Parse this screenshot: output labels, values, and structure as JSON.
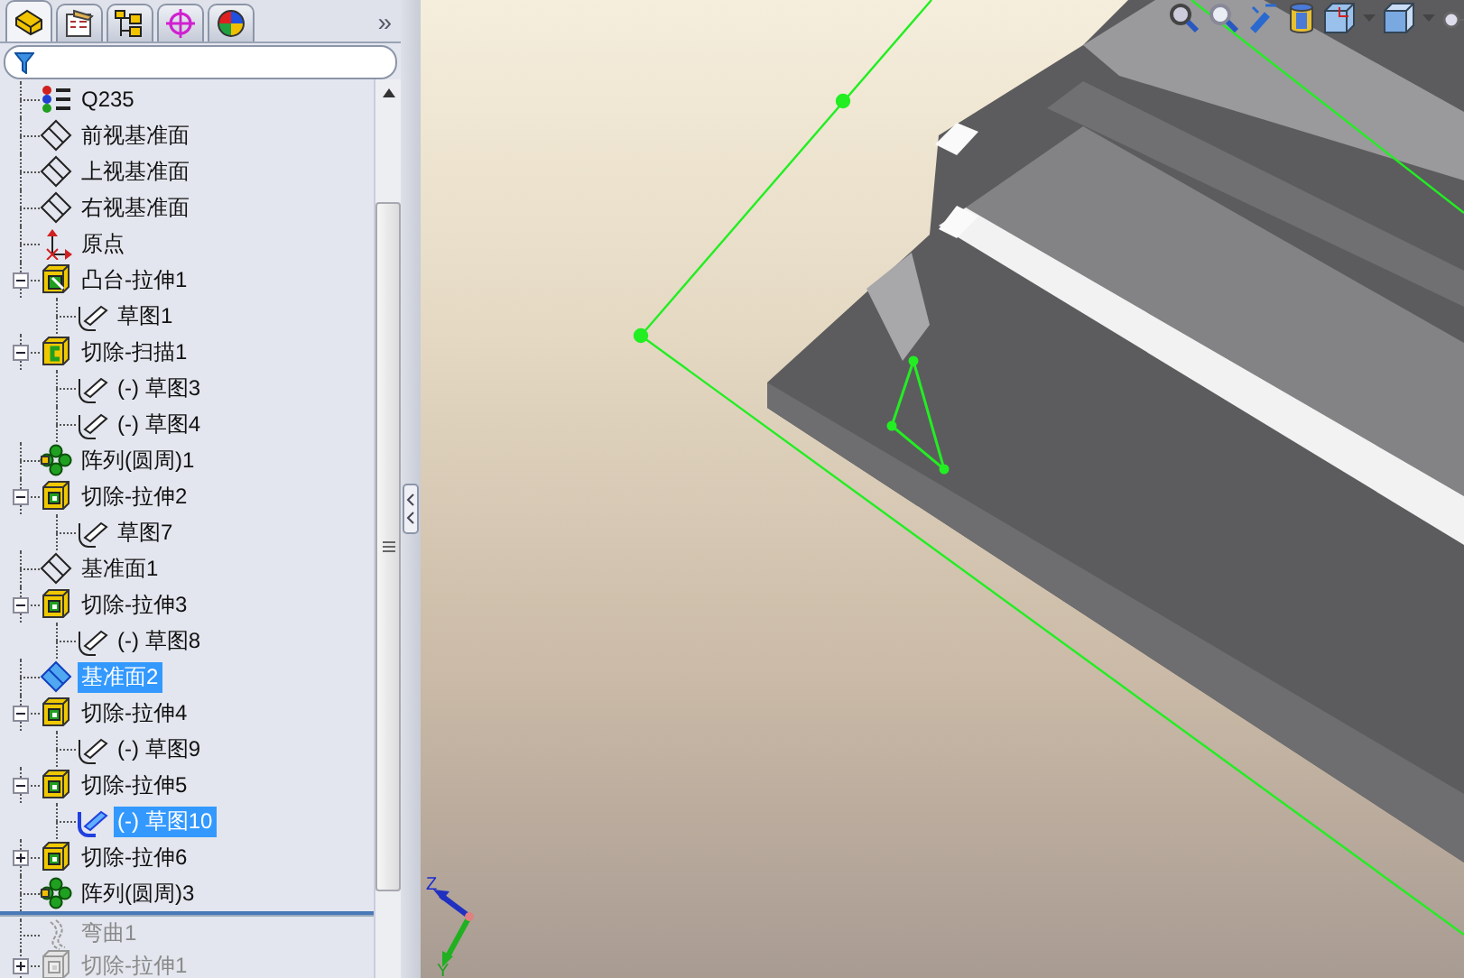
{
  "tabs": [
    {
      "kind": "features",
      "selected": true
    },
    {
      "kind": "properties",
      "selected": false
    },
    {
      "kind": "configurations",
      "selected": false
    },
    {
      "kind": "dimxpert",
      "selected": false
    },
    {
      "kind": "display",
      "selected": false
    }
  ],
  "more_tabs": "»",
  "tree": {
    "items": [
      {
        "label": "Q235",
        "kind": "material",
        "selected": false
      },
      {
        "label": "前视基准面",
        "kind": "plane",
        "selected": false
      },
      {
        "label": "上视基准面",
        "kind": "plane",
        "selected": false
      },
      {
        "label": "右视基准面",
        "kind": "plane",
        "selected": false
      },
      {
        "label": "原点",
        "kind": "origin",
        "selected": false
      },
      {
        "label": "凸台-拉伸1",
        "kind": "boss",
        "selected": false,
        "expanded": true,
        "children": [
          {
            "label": "草图1",
            "kind": "sketch",
            "selected": false
          }
        ]
      },
      {
        "label": "切除-扫描1",
        "kind": "sweep",
        "selected": false,
        "expanded": true,
        "children": [
          {
            "label": "(-) 草图3",
            "kind": "sketch",
            "selected": false
          },
          {
            "label": "(-) 草图4",
            "kind": "sketch",
            "selected": false
          }
        ]
      },
      {
        "label": "阵列(圆周)1",
        "kind": "pattern",
        "selected": false
      },
      {
        "label": "切除-拉伸2",
        "kind": "cut",
        "selected": false,
        "expanded": true,
        "children": [
          {
            "label": "草图7",
            "kind": "sketch",
            "selected": false
          }
        ]
      },
      {
        "label": "基准面1",
        "kind": "plane",
        "selected": false
      },
      {
        "label": "切除-拉伸3",
        "kind": "cut",
        "selected": false,
        "expanded": true,
        "children": [
          {
            "label": "(-) 草图8",
            "kind": "sketch",
            "selected": false
          }
        ]
      },
      {
        "label": "基准面2",
        "kind": "plane",
        "selected": true
      },
      {
        "label": "切除-拉伸4",
        "kind": "cut",
        "selected": false,
        "expanded": true,
        "children": [
          {
            "label": "(-) 草图9",
            "kind": "sketch",
            "selected": false
          }
        ]
      },
      {
        "label": "切除-拉伸5",
        "kind": "cut",
        "selected": false,
        "expanded": true,
        "children": [
          {
            "label": "(-) 草图10",
            "kind": "sketch",
            "selected": true
          }
        ]
      },
      {
        "label": "切除-拉伸6",
        "kind": "cut",
        "selected": false,
        "expanded": false
      },
      {
        "label": "阵列(圆周)3",
        "kind": "pattern",
        "selected": false
      }
    ],
    "rolled_back_items": [
      {
        "label": "弯曲1",
        "kind": "flex",
        "selected": false
      },
      {
        "label": "切除-拉伸1",
        "kind": "cut",
        "selected": false,
        "expanded": false
      }
    ]
  },
  "viewport": {
    "triad_labels": [
      "Z",
      "Y"
    ]
  }
}
